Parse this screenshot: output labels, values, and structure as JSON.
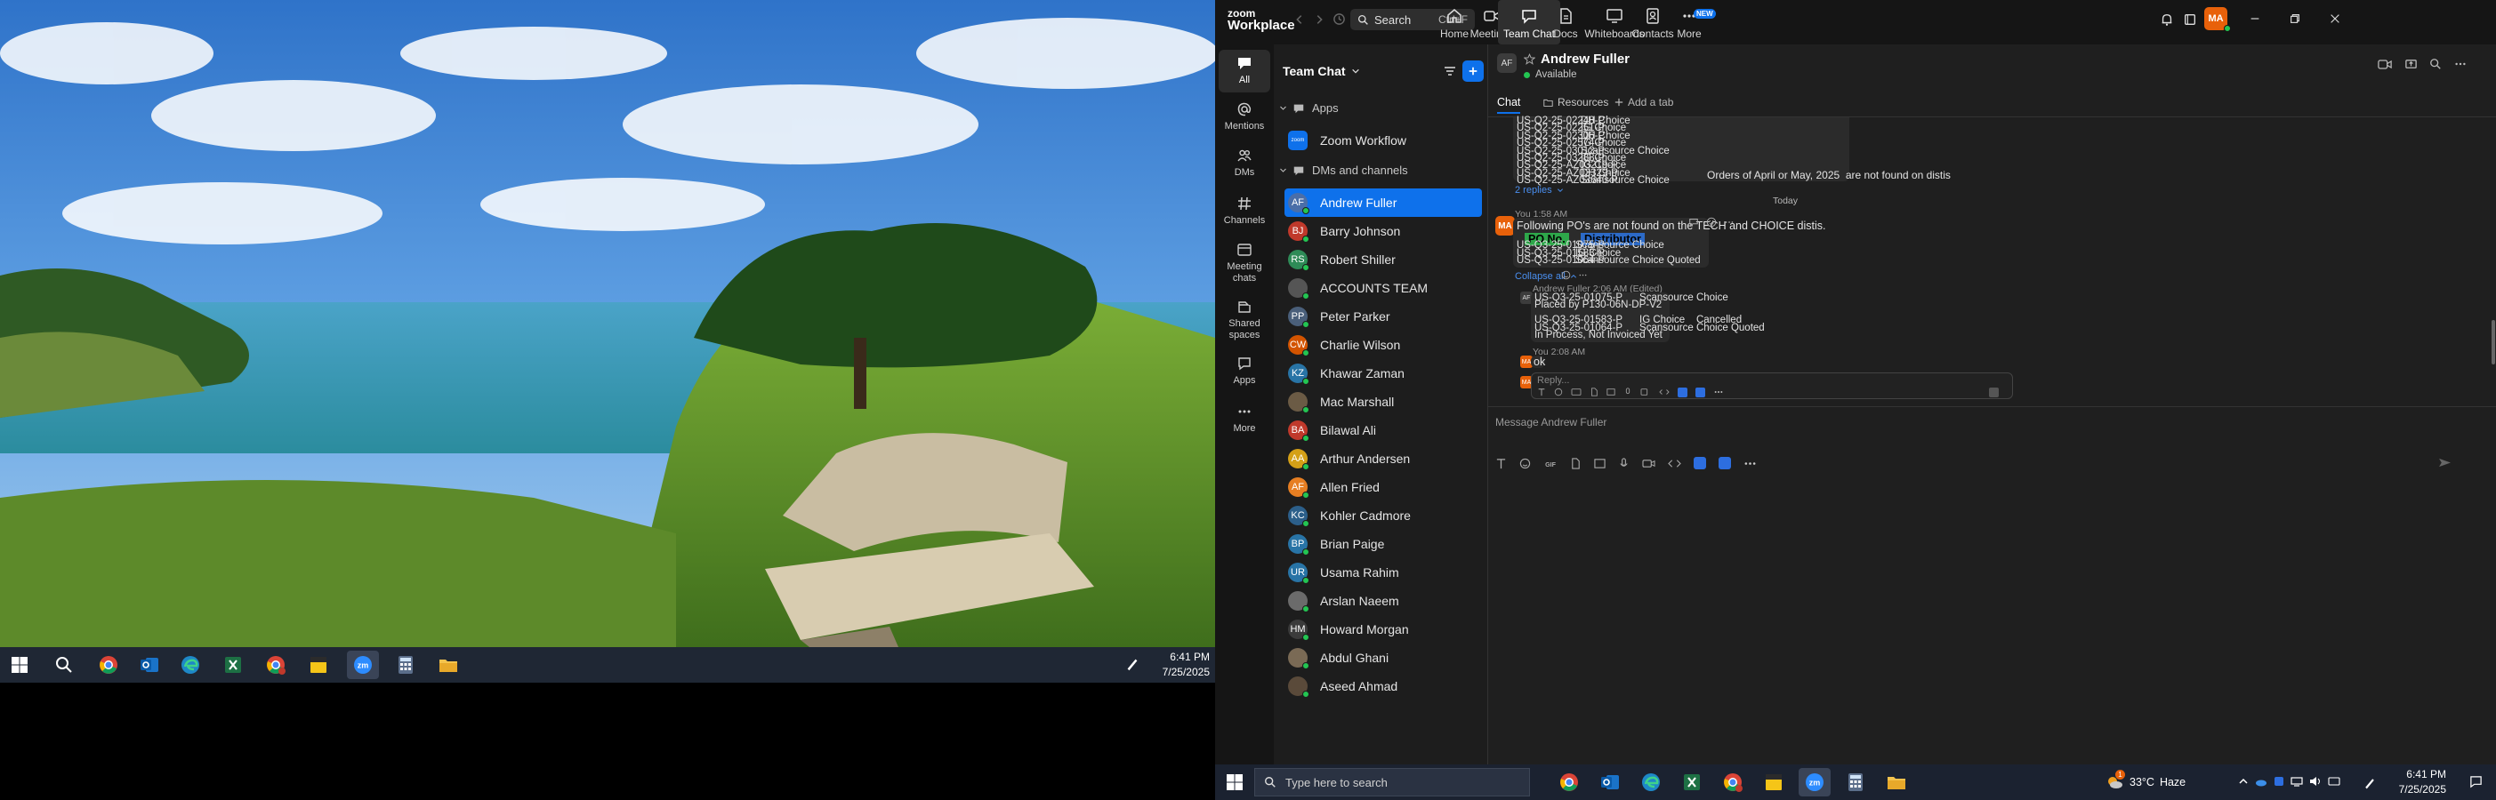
{
  "left_taskbar": {
    "clock_time": "6:41 PM",
    "clock_date": "7/25/2025",
    "icons": [
      "windows-logo",
      "search-icon",
      "chrome-icon",
      "outlook-icon",
      "edge-icon",
      "excel-icon",
      "chrome-profile-icon",
      "sticky-notes-icon",
      "zoom-icon",
      "calculator-icon",
      "file-explorer-icon",
      "pen-icon"
    ]
  },
  "zoom": {
    "logo_top": "zoom",
    "logo_bottom": "Workplace",
    "search_label": "Search",
    "search_shortcut": "Ctrl+F",
    "nav": [
      {
        "label": "Home",
        "icon": "home-icon"
      },
      {
        "label": "Meetings",
        "icon": "video-icon"
      },
      {
        "label": "Team Chat",
        "icon": "chat-icon"
      },
      {
        "label": "Docs",
        "icon": "doc-icon"
      },
      {
        "label": "Whiteboards",
        "icon": "whiteboard-icon"
      },
      {
        "label": "Contacts",
        "icon": "contacts-icon"
      },
      {
        "label": "More",
        "icon": "more-icon",
        "badge": "NEW"
      }
    ],
    "profile_initials": "MA"
  },
  "rail": [
    {
      "label": "All",
      "icon": "chat-bubble-icon"
    },
    {
      "label": "Mentions",
      "icon": "at-icon"
    },
    {
      "label": "DMs",
      "icon": "people-icon"
    },
    {
      "label": "Channels",
      "icon": "hash-icon"
    },
    {
      "label": "Meeting chats",
      "icon": "calendar-chat-icon"
    },
    {
      "label": "Shared spaces",
      "icon": "shared-icon"
    },
    {
      "label": "Apps",
      "icon": "apps-icon"
    },
    {
      "label": "More",
      "icon": "dots-icon"
    }
  ],
  "sidebar": {
    "title": "Team Chat",
    "section_apps": "Apps",
    "zoom_workflow": "Zoom Workflow",
    "section_dms": "DMs and channels",
    "contacts": [
      {
        "name": "Andrew Fuller",
        "initials": "AF",
        "color": "#4a6ea8",
        "active": true
      },
      {
        "name": "Barry Johnson",
        "initials": "BJ",
        "color": "#c0392b"
      },
      {
        "name": "Robert Shiller",
        "initials": "RS",
        "color": "#2e8b57"
      },
      {
        "name": "ACCOUNTS TEAM",
        "initials": "",
        "color": "#555555"
      },
      {
        "name": "Peter Parker",
        "initials": "PP",
        "color": "#4a5f7a"
      },
      {
        "name": "Charlie Wilson",
        "initials": "CW",
        "color": "#d35400"
      },
      {
        "name": "Khawar Zaman",
        "initials": "KZ",
        "color": "#2874a6"
      },
      {
        "name": "Mac Marshall",
        "initials": "",
        "color": "#6b5b45"
      },
      {
        "name": "Bilawal Ali",
        "initials": "BA",
        "color": "#c0392b"
      },
      {
        "name": "Arthur Andersen",
        "initials": "AA",
        "color": "#d4a017"
      },
      {
        "name": "Allen Fried",
        "initials": "AF",
        "color": "#e67e22"
      },
      {
        "name": "Kohler Cadmore",
        "initials": "KC",
        "color": "#2c5f8a"
      },
      {
        "name": "Brian Paige",
        "initials": "BP",
        "color": "#2874a6"
      },
      {
        "name": "Usama Rahim",
        "initials": "UR",
        "color": "#2874a6"
      },
      {
        "name": "Arslan Naeem",
        "initials": "",
        "color": "#6b6b6b"
      },
      {
        "name": "Howard Morgan",
        "initials": "HM",
        "color": "#3b3b3b"
      },
      {
        "name": "Abdul Ghani",
        "initials": "",
        "color": "#7a6a55"
      },
      {
        "name": "Aseed Ahmad",
        "initials": "",
        "color": "#5a4a3a"
      }
    ]
  },
  "chat": {
    "contact_name": "Andrew Fuller",
    "contact_initials": "AF",
    "status": "Available",
    "tabs": {
      "chat": "Chat",
      "resources": "Resources",
      "add": "Add a tab"
    },
    "earlier_lines": [
      [
        "US-Q2-25-02248-P",
        "DH Choice"
      ],
      [
        "US-Q2-25-02251-P",
        "IG Choice"
      ],
      [
        "US-Q2-25-02306-P",
        "DH Choice"
      ],
      [
        "US-Q2-25-02574-P",
        "IG Choice"
      ],
      [
        "US-Q2-25-03012-P",
        "Scansource Choice"
      ],
      [
        "US-Q2-25-03288-P",
        "IG Choice"
      ],
      [
        "US-Q2-25-AZ03219-P",
        "IG Choice"
      ],
      [
        "US-Q2-25-AZ03329-P",
        "DH Choice"
      ],
      [
        "US-Q2-25-AZ03640-P",
        "Scansource Choice"
      ]
    ],
    "earlier_note": "Orders of April or May, 2025  are not found on distis",
    "replies_link": "2 replies",
    "date_divider": "Today",
    "msg1": {
      "initials": "MA",
      "meta": "You 1:58 AM",
      "text": "Following PO's are not found on the TECH and CHOICE distis.",
      "header_po": "PO No.",
      "header_dist": "Distributor",
      "rows": [
        [
          "US-Q3-25-01075-P",
          "Scansource Choice"
        ],
        [
          "US-Q3-25-01583-P",
          "IG Choice"
        ],
        [
          "US-Q3-25-01064-P",
          "Scansource Choice Quoted"
        ]
      ],
      "collapse": "Collapse all"
    },
    "reply1": {
      "initials": "AF",
      "meta": "Andrew Fuller 2:06 AM (Edited)",
      "lines": [
        "US-Q3-25-01075-P      Scansource Choice",
        "Placed by P130-06N-DP-V2",
        "",
        "US-Q3-25-01583-P      IG Choice    Cancelled",
        "US-Q3-25-01064-P      Scansource Choice Quoted",
        "In Process, Not Invoiced Yet"
      ]
    },
    "reply2": {
      "initials": "MA",
      "meta": "You 2:08 AM",
      "text": "ok"
    },
    "reply_placeholder": "Reply...",
    "composer_placeholder": "Message Andrew Fuller"
  },
  "right_taskbar": {
    "search_placeholder": "Type here to search",
    "weather_temp": "33°C",
    "weather_text": "Haze",
    "weather_badge": "1",
    "clock_time": "6:41 PM",
    "clock_date": "7/25/2025"
  },
  "colors": {
    "accent": "#0e71eb",
    "online": "#23c552",
    "zoom_bg": "#1f1f1f"
  }
}
